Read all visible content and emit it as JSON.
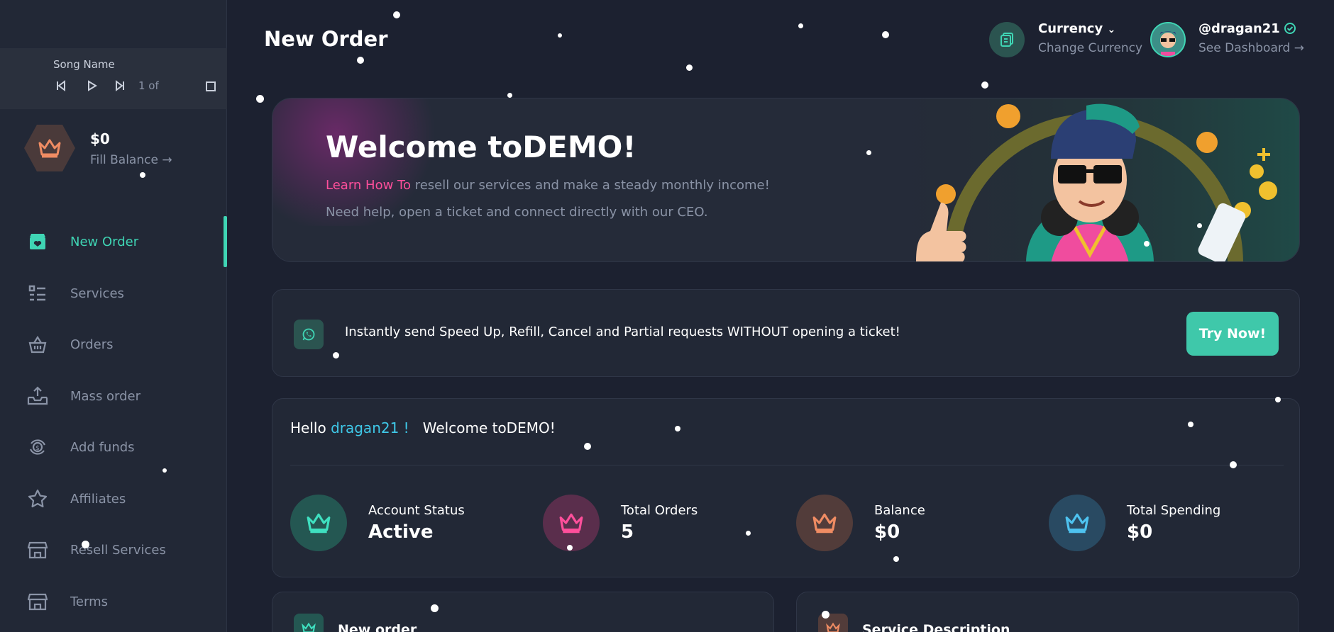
{
  "player": {
    "song_name": "Song Name",
    "count": "1 of"
  },
  "balance": {
    "amount": "$0",
    "fill_label": "Fill Balance →"
  },
  "nav": [
    {
      "label": "New Order",
      "icon": "box-heart-icon",
      "active": true
    },
    {
      "label": "Services",
      "icon": "list-icon"
    },
    {
      "label": "Orders",
      "icon": "basket-icon"
    },
    {
      "label": "Mass order",
      "icon": "upload-tray-icon"
    },
    {
      "label": "Add funds",
      "icon": "dollar-cycle-icon"
    },
    {
      "label": "Affiliates",
      "icon": "star-icon"
    },
    {
      "label": "Resell Services",
      "icon": "store-icon"
    },
    {
      "label": "Terms",
      "icon": "store-icon"
    }
  ],
  "header": {
    "title": "New Order",
    "currency_title": "Currency",
    "currency_sub": "Change Currency",
    "username": "@dragan21",
    "user_sub": "See Dashboard →"
  },
  "banner": {
    "title": "Welcome toDEMO!",
    "highlight": "Learn How To",
    "line1_rest": " resell our services and make a steady monthly income!",
    "line2": "Need help, open a ticket and connect directly with our CEO."
  },
  "promo": {
    "text": "Instantly send Speed Up, Refill, Cancel and Partial requests WITHOUT opening a ticket!",
    "button": "Try Now!"
  },
  "stats_card": {
    "hello_prefix": "Hello ",
    "username": "dragan21 !",
    "welcome": "Welcome toDEMO!",
    "items": [
      {
        "label": "Account Status",
        "value": "Active"
      },
      {
        "label": "Total Orders",
        "value": "5"
      },
      {
        "label": "Balance",
        "value": "$0"
      },
      {
        "label": "Total Spending",
        "value": "$0"
      }
    ]
  },
  "bottom": {
    "new_order": "New order",
    "service_description": "Service Description"
  },
  "colors": {
    "accent": "#3fd5b4",
    "pink": "#ff4f9b",
    "user_link": "#3fc8e8",
    "background": "#1c2130",
    "card": "#222836"
  }
}
